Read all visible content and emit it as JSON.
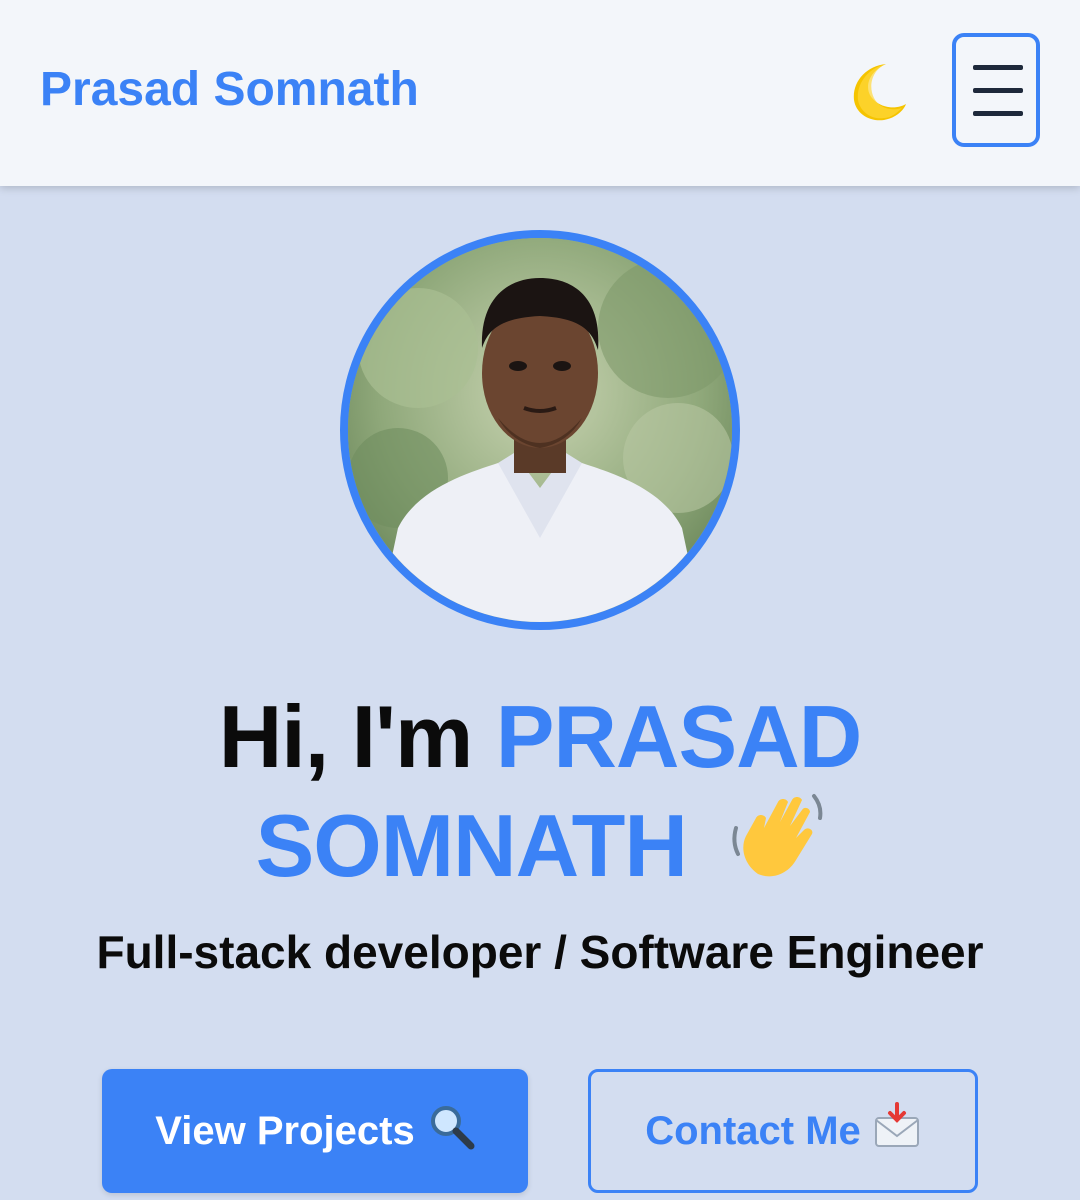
{
  "header": {
    "brand": "Prasad Somnath",
    "theme_toggle_icon": "crescent-moon-icon",
    "menu_icon": "hamburger-menu-icon"
  },
  "hero": {
    "greeting": "Hi, I'm",
    "name_line1": "PRASAD",
    "name_line2": "SOMNATH",
    "wave_icon": "waving-hand-icon",
    "subtitle": "Full-stack developer / Software Engineer",
    "buttons": {
      "primary_label": "View Projects",
      "primary_icon": "magnifying-glass-icon",
      "secondary_label": "Contact Me",
      "secondary_icon": "envelope-arrow-icon"
    }
  },
  "colors": {
    "accent": "#3b82f6",
    "background": "#d3ddf0",
    "header_bg": "#f3f6fa",
    "text": "#0b0b0b"
  }
}
